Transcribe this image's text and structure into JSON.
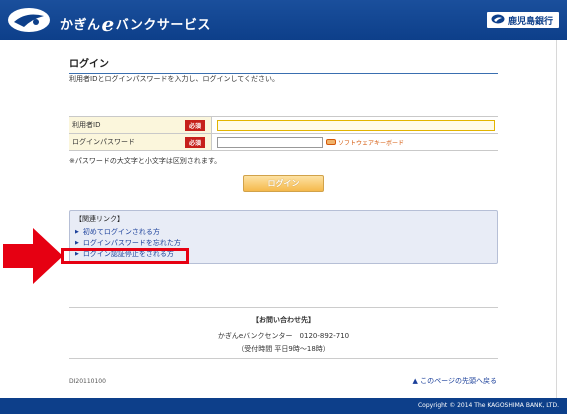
{
  "header": {
    "app_name_pre": "かぎん",
    "app_name_e": "e",
    "app_name_post": "バンクサービス",
    "bank_name": "鹿児島銀行",
    "brand_color": "#0d3f8a"
  },
  "page": {
    "title": "ログイン",
    "intro": "利用者IDとログインパスワードを入力し、ログインしてください。"
  },
  "form": {
    "user_id_label": "利用者ID",
    "password_label": "ログインパスワード",
    "required_badge": "必須",
    "user_id_value": "",
    "password_value": "",
    "software_keyboard_label": "ソフトウェアキーボード"
  },
  "note": "※パスワードの大文字と小文字は区別されます。",
  "login_button": "ログイン",
  "links": {
    "heading": "【関連リンク】",
    "items": [
      "初めてログインされる方",
      "ログインパスワードを忘れた方",
      "ログイン認証停止をされる方"
    ]
  },
  "contact": {
    "title": "【お問い合わせ先】",
    "center": "かぎんeバンクセンター　0120-892-710",
    "hours": "（受付時間 平日9時～18時）"
  },
  "page_id": "DI20110100",
  "back_to_top": "▲ このページの先頭へ戻る",
  "footer": "Copyright © 2014 The KAGOSHIMA BANK, LTD."
}
